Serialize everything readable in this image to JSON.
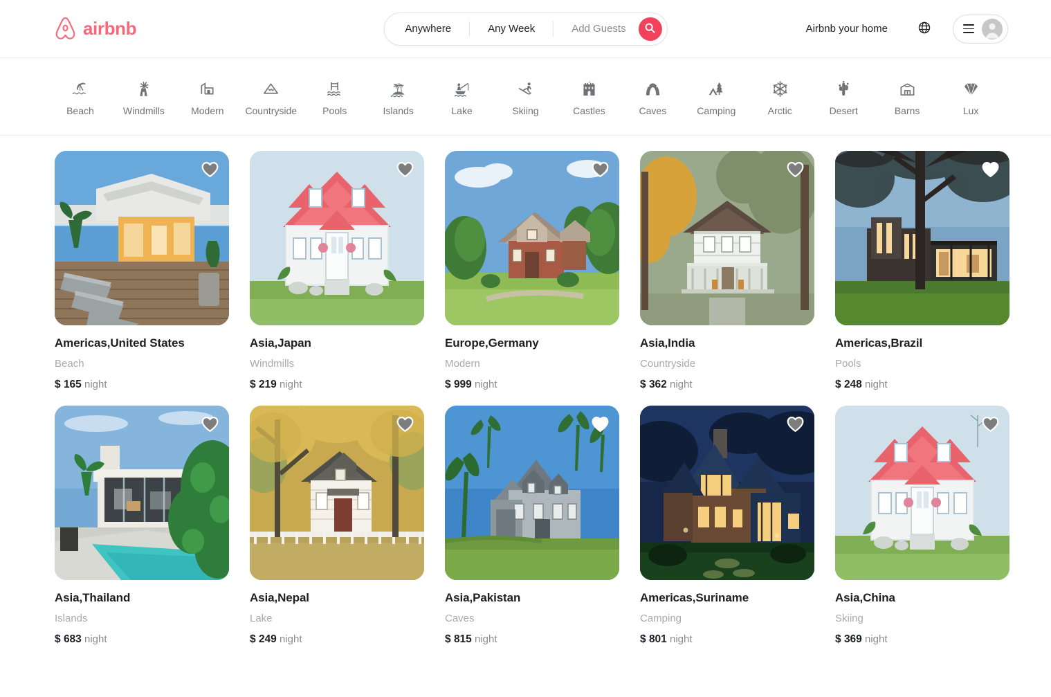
{
  "header": {
    "brand": {
      "name": "airbnb",
      "icon": "airbnb-belo-icon",
      "color": "#f8687a"
    },
    "search": {
      "where_label": "Anywhere",
      "when_label": "Any Week",
      "guests_label": "Add Guests",
      "search_icon": "search-icon",
      "button_color": "#f2415a"
    },
    "host_link": "Airbnb your home",
    "globe_icon": "globe-icon",
    "menu_icon": "hamburger-menu-icon",
    "avatar_icon": "user-avatar-icon"
  },
  "categories": [
    {
      "label": "Beach",
      "icon": "beach-umbrella-icon"
    },
    {
      "label": "Windmills",
      "icon": "windmill-icon"
    },
    {
      "label": "Modern",
      "icon": "modern-building-icon"
    },
    {
      "label": "Countryside",
      "icon": "mountain-icon"
    },
    {
      "label": "Pools",
      "icon": "pool-ladder-icon"
    },
    {
      "label": "Islands",
      "icon": "palm-island-icon"
    },
    {
      "label": "Lake",
      "icon": "fishing-boat-icon"
    },
    {
      "label": "Skiing",
      "icon": "skier-icon"
    },
    {
      "label": "Castles",
      "icon": "castle-icon"
    },
    {
      "label": "Caves",
      "icon": "cave-icon"
    },
    {
      "label": "Camping",
      "icon": "tent-tree-icon"
    },
    {
      "label": "Arctic",
      "icon": "snowflake-icon"
    },
    {
      "label": "Desert",
      "icon": "cactus-icon"
    },
    {
      "label": "Barns",
      "icon": "barn-icon"
    },
    {
      "label": "Lux",
      "icon": "diamond-icon"
    }
  ],
  "listings": [
    {
      "title": "Americas,United States",
      "category": "Beach",
      "currency": "$",
      "price": "165",
      "unit": "night",
      "image": "beach-deck-lounge-chairs",
      "favorite_icon": "heart-icon"
    },
    {
      "title": "Asia,Japan",
      "category": "Windmills",
      "currency": "$",
      "price": "219",
      "unit": "night",
      "image": "white-house-red-roof",
      "favorite_icon": "heart-icon"
    },
    {
      "title": "Europe,Germany",
      "category": "Modern",
      "currency": "$",
      "price": "999",
      "unit": "night",
      "image": "brick-cottage-green-lawn",
      "favorite_icon": "heart-icon"
    },
    {
      "title": "Asia,India",
      "category": "Countryside",
      "currency": "$",
      "price": "362",
      "unit": "night",
      "image": "autumn-farmhouse-porch",
      "favorite_icon": "heart-icon"
    },
    {
      "title": "Americas,Brazil",
      "category": "Pools",
      "currency": "$",
      "price": "248",
      "unit": "night",
      "image": "modern-glass-house-dusk",
      "favorite_icon": "heart-icon"
    },
    {
      "title": "Asia,Thailand",
      "category": "Islands",
      "currency": "$",
      "price": "683",
      "unit": "night",
      "image": "white-villa-turquoise-pool",
      "favorite_icon": "heart-icon"
    },
    {
      "title": "Asia,Nepal",
      "category": "Lake",
      "currency": "$",
      "price": "249",
      "unit": "night",
      "image": "cottage-white-picket-fence",
      "favorite_icon": "heart-icon"
    },
    {
      "title": "Asia,Pakistan",
      "category": "Caves",
      "currency": "$",
      "price": "815",
      "unit": "night",
      "image": "grey-gabled-house-palms",
      "favorite_icon": "heart-icon"
    },
    {
      "title": "Americas,Suriname",
      "category": "Camping",
      "currency": "$",
      "price": "801",
      "unit": "night",
      "image": "lit-lodge-twilight",
      "favorite_icon": "heart-icon"
    },
    {
      "title": "Asia,China",
      "category": "Skiing",
      "currency": "$",
      "price": "369",
      "unit": "night",
      "image": "white-house-red-roof",
      "favorite_icon": "heart-icon"
    }
  ]
}
